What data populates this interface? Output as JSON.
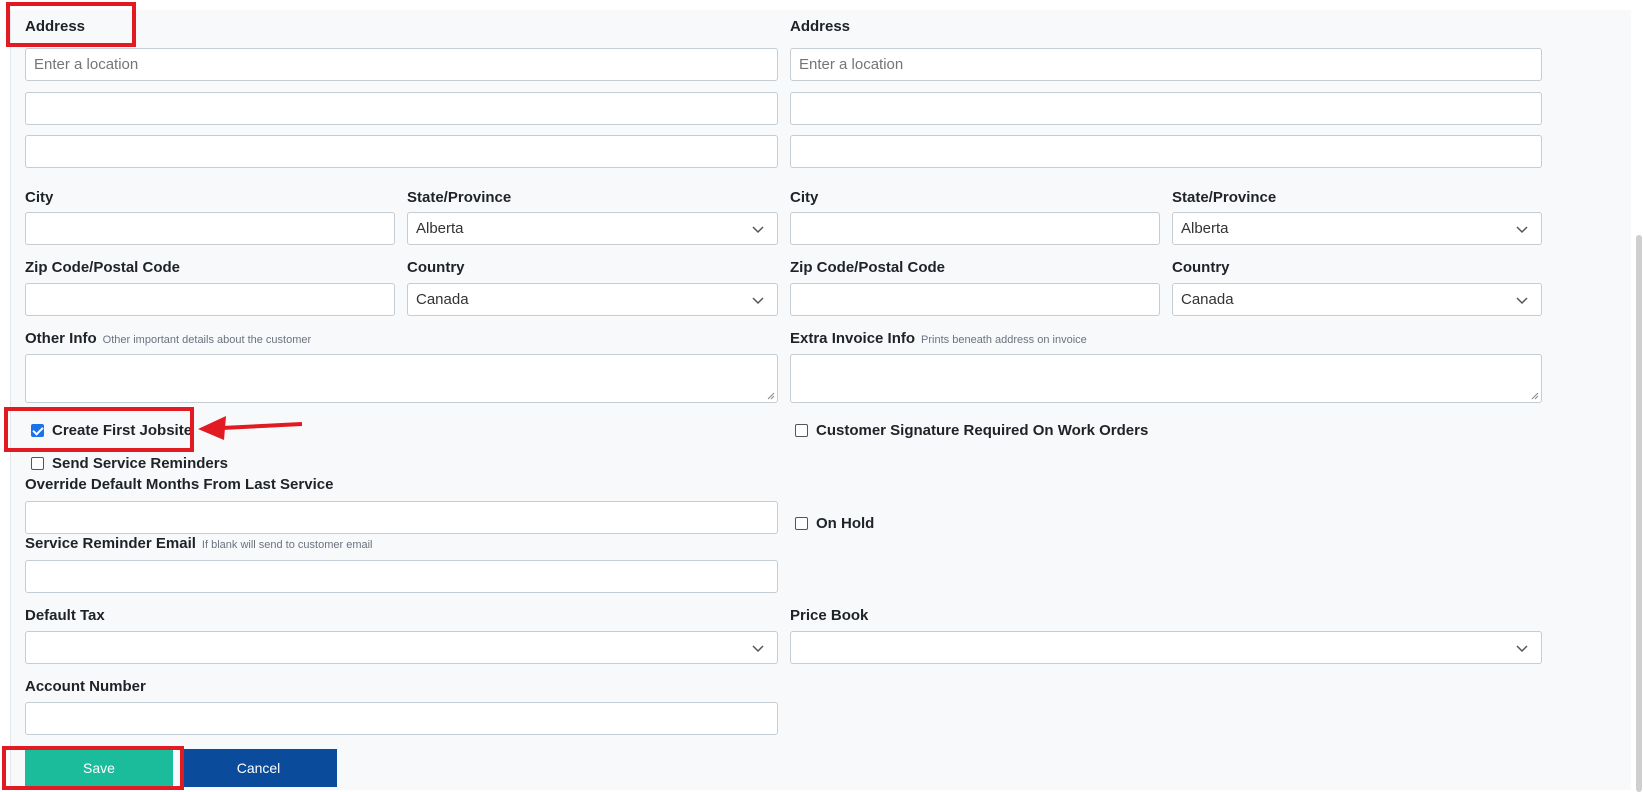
{
  "left": {
    "address_label": "Address",
    "address_placeholder": "Enter a location",
    "city_label": "City",
    "state_label": "State/Province",
    "state_value": "Alberta",
    "zip_label": "Zip Code/Postal Code",
    "country_label": "Country",
    "country_value": "Canada",
    "other_info_label": "Other Info",
    "other_info_hint": "Other important details about the customer",
    "create_first_jobsite_label": "Create First Jobsite",
    "create_first_jobsite_checked": true,
    "send_reminders_label": "Send Service Reminders",
    "send_reminders_checked": false,
    "override_months_label": "Override Default Months From Last Service",
    "reminder_email_label": "Service Reminder Email",
    "reminder_email_hint": "If blank will send to customer email",
    "default_tax_label": "Default Tax",
    "account_number_label": "Account Number"
  },
  "right": {
    "address_label": "Address",
    "address_placeholder": "Enter a location",
    "city_label": "City",
    "state_label": "State/Province",
    "state_value": "Alberta",
    "zip_label": "Zip Code/Postal Code",
    "country_label": "Country",
    "country_value": "Canada",
    "extra_invoice_label": "Extra Invoice Info",
    "extra_invoice_hint": "Prints beneath address on invoice",
    "signature_required_label": "Customer Signature Required On Work Orders",
    "signature_required_checked": false,
    "on_hold_label": "On Hold",
    "on_hold_checked": false,
    "price_book_label": "Price Book"
  },
  "buttons": {
    "save": "Save",
    "cancel": "Cancel"
  },
  "colors": {
    "save": "#1abc9c",
    "cancel": "#0b4b9c",
    "highlight": "#e21b23"
  }
}
